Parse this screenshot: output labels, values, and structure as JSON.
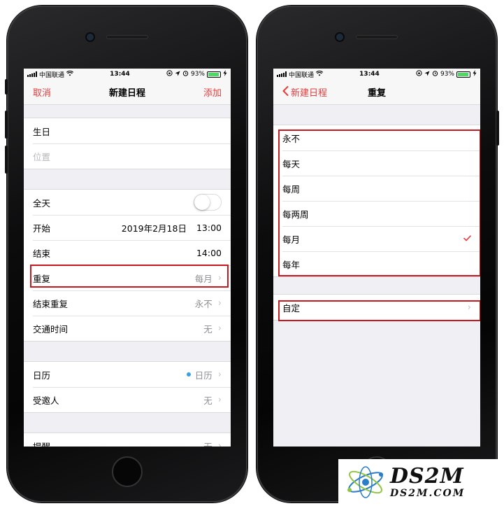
{
  "status_bar": {
    "carrier": "中国联通",
    "time": "13:44",
    "battery_percent": "93%",
    "battery_level": 0.93
  },
  "left_screen": {
    "nav": {
      "cancel_label": "取消",
      "title": "新建日程",
      "add_label": "添加"
    },
    "group1": [
      {
        "label": "生日"
      },
      {
        "placeholder": "位置"
      }
    ],
    "group2": [
      {
        "label": "全天",
        "toggle_on": false
      },
      {
        "label": "开始",
        "date": "2019年2月18日",
        "time": "13:00"
      },
      {
        "label": "结束",
        "time": "14:00"
      },
      {
        "label": "重复",
        "value": "每月"
      },
      {
        "label": "结束重复",
        "value": "永不"
      },
      {
        "label": "交通时间",
        "value": "无"
      }
    ],
    "group3": [
      {
        "label": "日历",
        "value": "日历",
        "dot_color": "#3aa0e6"
      },
      {
        "label": "受邀人",
        "value": "无"
      }
    ],
    "group4": [
      {
        "label": "提醒",
        "value": "无"
      }
    ]
  },
  "right_screen": {
    "nav": {
      "back_label": "新建日程",
      "title": "重复"
    },
    "options": [
      {
        "label": "永不"
      },
      {
        "label": "每天"
      },
      {
        "label": "每周"
      },
      {
        "label": "每两周"
      },
      {
        "label": "每月",
        "selected": true
      },
      {
        "label": "每年"
      }
    ],
    "custom_label": "自定"
  },
  "watermark": {
    "brand": "DS2M",
    "domain": "DS2M.COM"
  },
  "colors": {
    "accent_red": "#e63c3c",
    "highlight_box": "#c9191e",
    "calendar_dot": "#3aa0e6",
    "battery_green": "#4cd964",
    "group_background": "#efeff4"
  }
}
